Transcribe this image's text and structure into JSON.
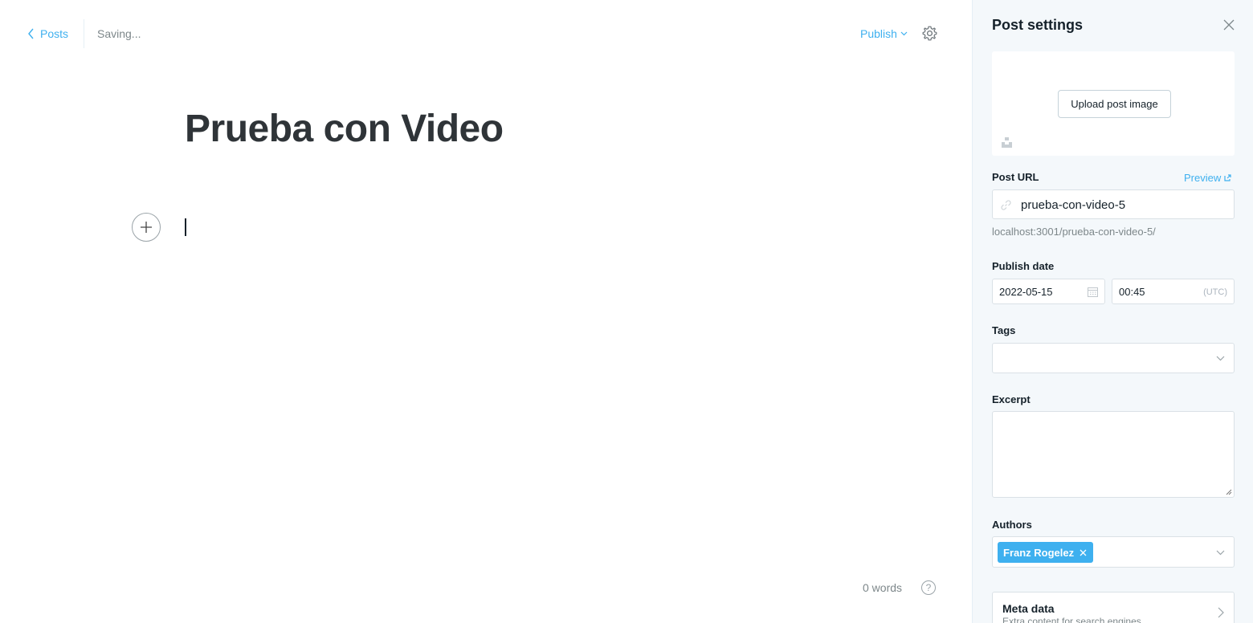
{
  "header": {
    "back_label": "Posts",
    "status": "Saving...",
    "publish_label": "Publish"
  },
  "post": {
    "title": "Prueba con Video",
    "word_count": "0 words"
  },
  "panel": {
    "title": "Post settings",
    "upload_label": "Upload post image",
    "post_url_label": "Post URL",
    "preview_label": "Preview",
    "slug": "prueba-con-video-5",
    "url_hint": "localhost:3001/prueba-con-video-5/",
    "publish_date_label": "Publish date",
    "date": "2022-05-15",
    "time": "00:45",
    "timezone": "(UTC)",
    "tags_label": "Tags",
    "excerpt_label": "Excerpt",
    "authors_label": "Authors",
    "authors": [
      "Franz Rogelez"
    ],
    "meta_title": "Meta data",
    "meta_sub": "Extra content for search engines"
  },
  "colors": {
    "accent": "#3eb0ef",
    "panel_bg": "#f4f8fb",
    "text": "#15212a",
    "muted": "#7d878a"
  },
  "icons": [
    "chevron-left-icon",
    "chevron-down-icon",
    "gear-icon",
    "plus-icon",
    "help-icon",
    "close-icon",
    "unsplash-icon",
    "external-link-icon",
    "link-icon",
    "calendar-icon",
    "chevron-right-icon"
  ]
}
